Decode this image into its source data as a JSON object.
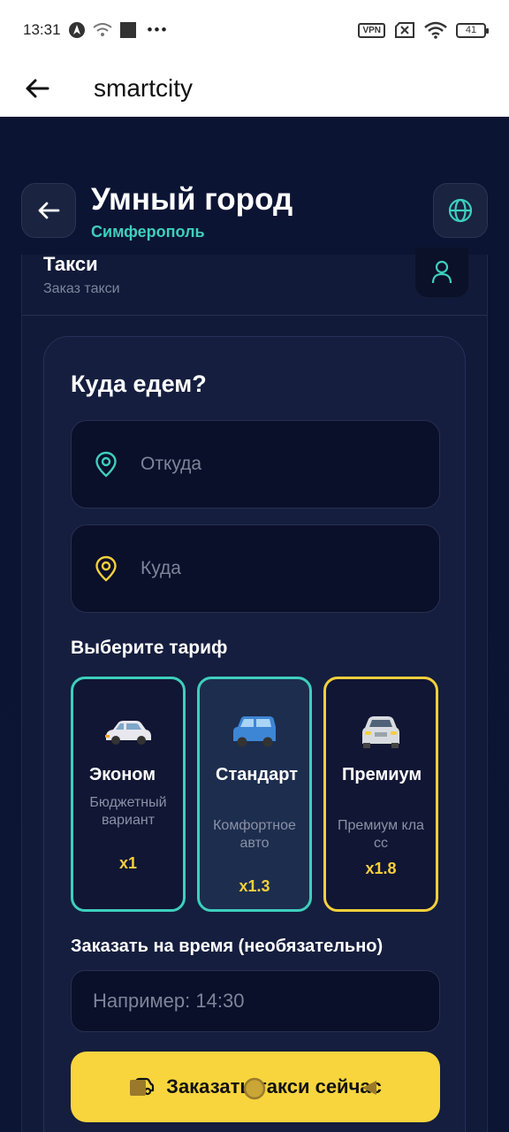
{
  "status_bar": {
    "time": "13:31",
    "more": "•••",
    "vpn": "VPN",
    "battery": "41"
  },
  "app_bar": {
    "title": "smartcity"
  },
  "header": {
    "title": "Умный город",
    "subtitle": "Симферополь"
  },
  "section": {
    "title": "Такси",
    "subtitle": "Заказ такси"
  },
  "form": {
    "title": "Куда едем?",
    "from_placeholder": "Откуда",
    "to_placeholder": "Куда",
    "tariff_label": "Выберите тариф",
    "tariffs": [
      {
        "name": "Эконом",
        "desc": "Бюджетный вариант",
        "mult": "x1",
        "icon": "car-icon"
      },
      {
        "name": "Стандарт",
        "desc": "Комфортное авто",
        "mult": "x1.3",
        "icon": "suv-icon"
      },
      {
        "name": "Премиум",
        "desc": "Премиум класс",
        "mult": "x1.8",
        "icon": "premium-car-icon"
      }
    ],
    "time_label": "Заказать на время (необязательно)",
    "time_placeholder": "Например: 14:30",
    "order_button": "Заказать такси сейчас"
  },
  "colors": {
    "accent_teal": "#3ecfbd",
    "accent_yellow": "#f8d53d",
    "background": "#0c1433"
  }
}
